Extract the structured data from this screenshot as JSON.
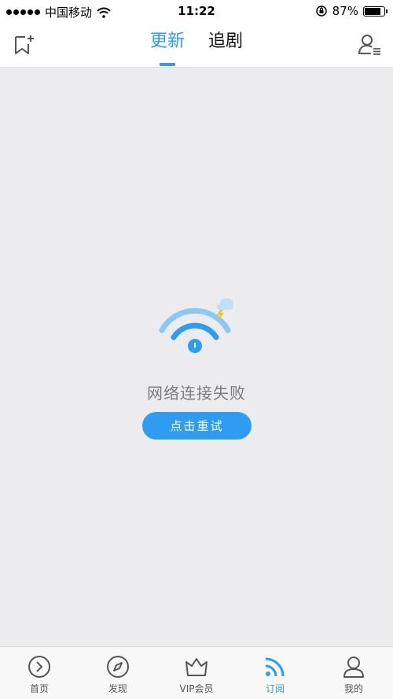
{
  "status_bar": {
    "carrier": "中国移动",
    "time": "11:22",
    "battery_percent": "87%",
    "battery_level": 0.87
  },
  "header": {
    "tabs": [
      {
        "label": "更新",
        "active": true
      },
      {
        "label": "追剧",
        "active": false
      }
    ],
    "left_icon": "bookmark-add-icon",
    "right_icon": "user-list-icon"
  },
  "main": {
    "error_icon": "network-error-icon",
    "error_message": "网络连接失败",
    "retry_label": "点击重试"
  },
  "bottom_nav": {
    "items": [
      {
        "label": "首页",
        "icon": "play-circle-icon",
        "active": false
      },
      {
        "label": "发现",
        "icon": "compass-icon",
        "active": false
      },
      {
        "label": "VIP会员",
        "icon": "crown-icon",
        "active": false
      },
      {
        "label": "订阅",
        "icon": "rss-icon",
        "active": true
      },
      {
        "label": "我的",
        "icon": "person-icon",
        "active": false
      }
    ]
  },
  "colors": {
    "accent": "#2e9cf0",
    "background": "#ececef"
  }
}
